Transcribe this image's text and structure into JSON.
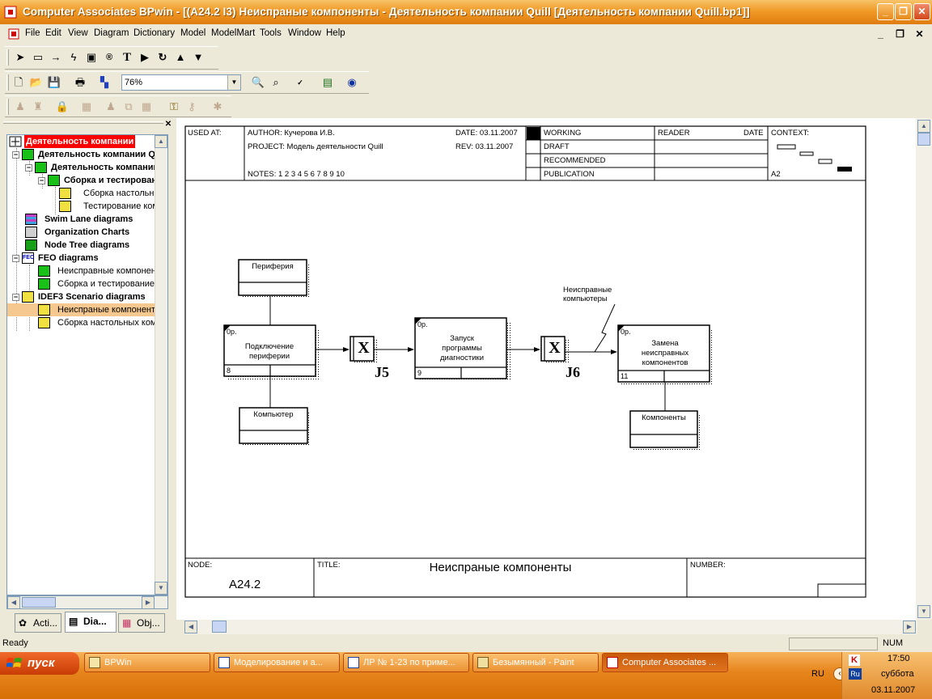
{
  "window": {
    "title": "Computer Associates BPwin - [(A24.2 I3) Неиспраные компоненты - Деятельность компании Quill  [Деятельность компании Quill.bp1]]",
    "icon": "bpwin-app-icon"
  },
  "menu": [
    "File",
    "Edit",
    "View",
    "Diagram",
    "Dictionary",
    "Model",
    "ModelMart",
    "Tools",
    "Window",
    "Help"
  ],
  "toolbar": {
    "zoom": "76%",
    "tools": [
      "pointer-tool",
      "activity-box-tool",
      "arrow-tool",
      "squiggle-tool",
      "off-page-tool",
      "referent-tool",
      "text-tool",
      "go-to-sub-tool",
      "go-to-parent-tool"
    ]
  },
  "tree": {
    "root": "Деятельность компании",
    "items": [
      {
        "label": "Деятельность компании Quill",
        "icon": "idef0-icon",
        "level": 1,
        "bold": true
      },
      {
        "label": "Деятельность компании Quill",
        "icon": "idef0-icon",
        "level": 2,
        "bold": true
      },
      {
        "label": "Сборка и тестирование",
        "icon": "idef0-icon",
        "level": 3,
        "bold": true
      },
      {
        "label": "Сборка настольных компьютеров",
        "icon": "idef3-icon",
        "level": 4,
        "bold": false
      },
      {
        "label": "Тестирование компьютеров",
        "icon": "idef3-icon",
        "level": 4,
        "bold": false
      },
      {
        "label": "Swim Lane diagrams",
        "icon": "swimlane-icon",
        "level": 1,
        "bold": true
      },
      {
        "label": "Organization Charts",
        "icon": "orgchart-icon",
        "level": 1,
        "bold": true
      },
      {
        "label": "Node Tree diagrams",
        "icon": "nodetree-icon",
        "level": 1,
        "bold": true
      },
      {
        "label": "FEO diagrams",
        "icon": "feo-icon",
        "level": 1,
        "bold": true
      },
      {
        "label": "Неисправные компоненты",
        "icon": "idef0-icon",
        "level": 2,
        "bold": false
      },
      {
        "label": "Сборка и тестирование",
        "icon": "idef0-icon",
        "level": 2,
        "bold": false
      },
      {
        "label": "IDEF3 Scenario diagrams",
        "icon": "idef3-icon",
        "level": 1,
        "bold": true
      },
      {
        "label": "Неиспраные компоненты",
        "icon": "idef3-icon",
        "level": 2,
        "bold": false,
        "selected": true
      },
      {
        "label": "Сборка настольных компьютеров",
        "icon": "idef3-icon",
        "level": 2,
        "bold": false
      }
    ],
    "tabs": [
      "Acti...",
      "Dia...",
      "Obj..."
    ]
  },
  "header": {
    "used_at": "USED AT:",
    "author": "AUTHOR:  Кучерова И.В.",
    "project": "PROJECT:  Модель деятельности Quill",
    "notes": "NOTES:  1  2  3  4  5  6  7  8  9  10",
    "date": "DATE: 03.11.2007",
    "rev": "REV:    03.11.2007",
    "status": [
      "WORKING",
      "DRAFT",
      "RECOMMENDED",
      "PUBLICATION"
    ],
    "reader": "READER",
    "date_col": "DATE",
    "context": "CONTEXT:",
    "context_node": "A2"
  },
  "footer": {
    "node_label": "NODE:",
    "node": "A24.2",
    "title_label": "TITLE:",
    "title": "Неиспраные компоненты",
    "number_label": "NUMBER:"
  },
  "diagram": {
    "uobs": [
      {
        "label": "Подключение периферии",
        "number": "8",
        "tag": "0р."
      },
      {
        "label": "Запуск программы диагностики",
        "number": "9",
        "tag": "0р."
      },
      {
        "label": "Замена неисправных компонентов",
        "number": "11",
        "tag": "0р."
      }
    ],
    "referents": [
      "Периферия",
      "Компьютер",
      "Компоненты"
    ],
    "junctions": [
      {
        "symbol": "X",
        "label": "J5"
      },
      {
        "symbol": "X",
        "label": "J6"
      }
    ],
    "note": "Неисправные компьютеры"
  },
  "status": {
    "text": "Ready",
    "num": "NUM"
  },
  "taskbar": {
    "start": "пуск",
    "tasks": [
      "BPWin",
      "Моделирование и а...",
      "ЛР № 1-23 по приме...",
      "Безымянный - Paint",
      "Computer Associates ..."
    ],
    "lang": "RU",
    "time": "17:50",
    "day": "суббота",
    "date": "03.11.2007"
  },
  "colors": {
    "titlebar": "#f09a26",
    "selection": "#f5c890",
    "tree_root": "#ff0000",
    "taskbar": "#e7861e"
  }
}
